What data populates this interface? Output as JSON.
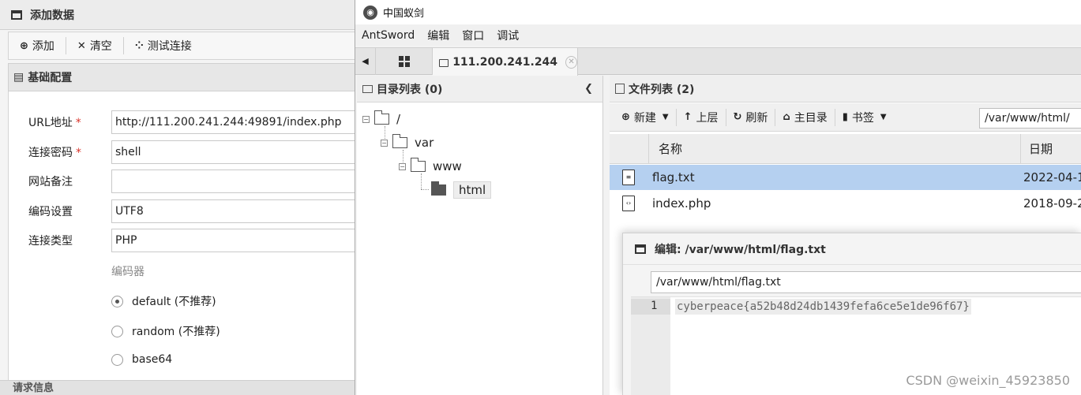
{
  "add_dialog": {
    "title": "添加数据",
    "toolbar": {
      "add_label": "添加",
      "clear_label": "清空",
      "test_label": "测试连接"
    },
    "basic_section_label": "基础配置",
    "fields": {
      "url_label": "URL地址",
      "url_value": "http://111.200.241.244:49891/index.php",
      "password_label": "连接密码",
      "password_value": "shell",
      "note_label": "网站备注",
      "note_value": "",
      "encoding_label": "编码设置",
      "encoding_value": "UTF8",
      "type_label": "连接类型",
      "type_value": "PHP"
    },
    "required_mark": "*",
    "encoder_title": "编码器",
    "encoders": [
      {
        "label": "default (不推荐)",
        "checked": true
      },
      {
        "label": "random (不推荐)",
        "checked": false
      },
      {
        "label": "base64",
        "checked": false
      }
    ],
    "request_section_label": "请求信息"
  },
  "antsword": {
    "window_title": "中国蚁剑",
    "menu": [
      "AntSword",
      "编辑",
      "窗口",
      "调试"
    ],
    "tab_label": "111.200.241.244",
    "dir_panel_title": "目录列表 (0)",
    "tree": [
      "/",
      "var",
      "www",
      "html"
    ],
    "file_panel_title": "文件列表 (2)",
    "file_toolbar": {
      "new": "新建",
      "up": "上层",
      "refresh": "刷新",
      "home": "主目录",
      "bookmark": "书签"
    },
    "current_path": "/var/www/html/",
    "columns": {
      "name": "名称",
      "date": "日期"
    },
    "files": [
      {
        "name": "flag.txt",
        "date": "2022-04-1"
      },
      {
        "name": "index.php",
        "date": "2018-09-2"
      }
    ],
    "editor": {
      "title": "编辑: /var/www/html/flag.txt",
      "path": "/var/www/html/flag.txt",
      "line_number": "1",
      "content": "cyberpeace{a52b48d24db1439fefa6ce5e1de96f67}"
    }
  },
  "watermark": "CSDN @weixin_45923850",
  "colors": {
    "selected_row": "#b5d0f0",
    "required": "#d9342b"
  }
}
